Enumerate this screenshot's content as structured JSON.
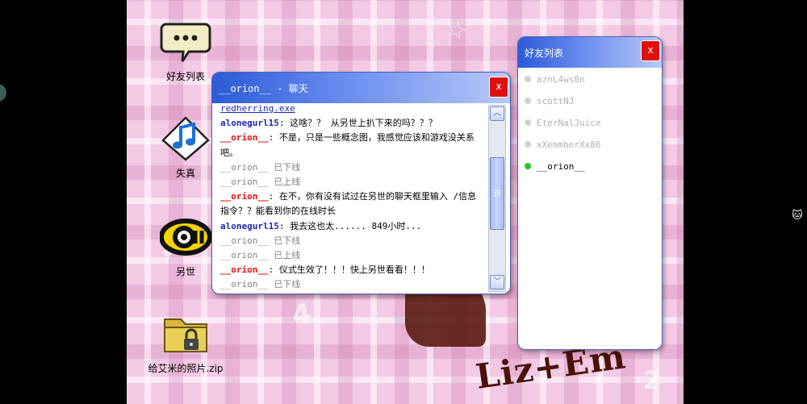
{
  "desktop": {
    "icons": [
      {
        "label": "好友列表",
        "icon": "chat-bubble-icon"
      },
      {
        "label": "失真",
        "icon": "music-note-icon"
      },
      {
        "label": "另世",
        "icon": "eye-logo-icon"
      },
      {
        "label": "给艾米的照片.zip",
        "icon": "zip-folder-icon"
      }
    ],
    "wallpaper_text": "Liz+Em"
  },
  "chat_window": {
    "title": "__orion__ - 聊天",
    "close_label": "x",
    "messages": [
      {
        "type": "link",
        "text": "redherring.exe"
      },
      {
        "type": "msg",
        "sender": "alonegurl15",
        "color": "blue",
        "text": ": 这啥？？ 从另世上扒下来的吗？？？"
      },
      {
        "type": "msg",
        "sender": "__orion__",
        "color": "red",
        "text": ": 不是，只是一些概念图，我感觉应该和游戏没关系吧。"
      },
      {
        "type": "sys",
        "text": "__orion__ 已下线"
      },
      {
        "type": "sys",
        "text": "__orion__ 已上线"
      },
      {
        "type": "msg",
        "sender": "__orion__",
        "color": "red",
        "text": ": 在不，你有没有试过在另世的聊天框里输入 /信息 指令？？能看到你的在线时长"
      },
      {
        "type": "msg",
        "sender": "alonegurl15",
        "color": "blue",
        "text": ": 我去这也太...... 849小时..."
      },
      {
        "type": "sys",
        "text": "__orion__ 已下线"
      },
      {
        "type": "sys",
        "text": "__orion__ 已上线"
      },
      {
        "type": "msg",
        "sender": "__orion__",
        "color": "red",
        "text": ": 仪式生效了！！！快上另世看看！！！"
      },
      {
        "type": "sys",
        "text": "__orion__ 已下线"
      }
    ]
  },
  "friends_window": {
    "title": "好友列表",
    "close_label": "x",
    "friends": [
      {
        "name": "aznL4ws0n",
        "status": "offline"
      },
      {
        "name": "scottNJ",
        "status": "offline"
      },
      {
        "name": "EterNalJuice",
        "status": "offline"
      },
      {
        "name": "xXemmberXx86",
        "status": "offline"
      },
      {
        "name": "__orion__",
        "status": "online"
      }
    ]
  },
  "scrollbar_position": 0.45,
  "colors": {
    "title_gradient_start": "#2c5bd6",
    "close_red": "#e01010",
    "sender_blue": "#1a28b8",
    "sender_red": "#e01010",
    "online_green": "#22cc22",
    "wallpaper_pink": "#f3c9e4"
  },
  "side_tool": {
    "icon": "cat-icon"
  }
}
